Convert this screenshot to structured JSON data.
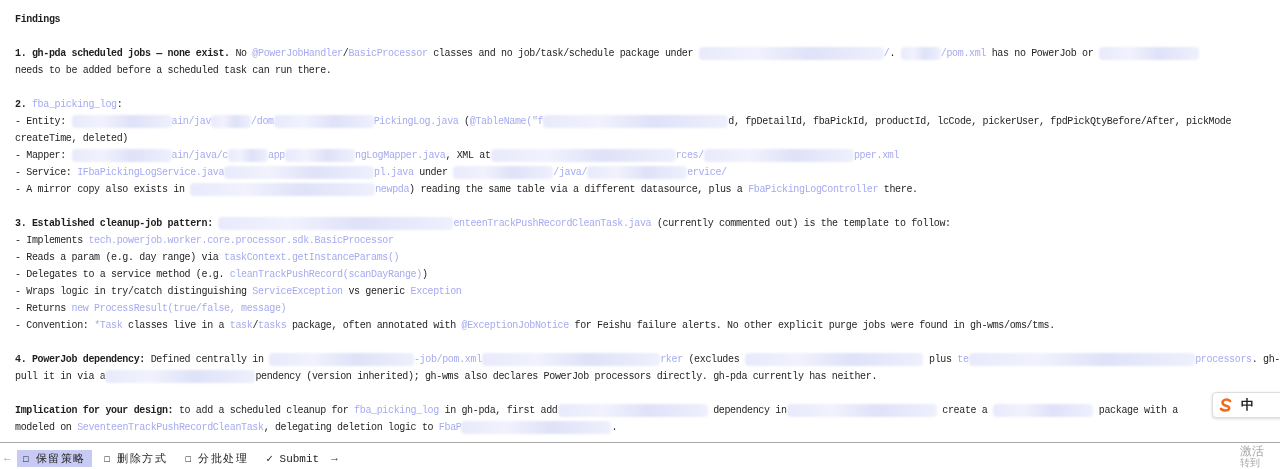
{
  "title": "Findings",
  "sections": [
    {
      "lines": [
        [
          {
            "kind": "bold",
            "t": "1. gh-pda scheduled jobs — none exist."
          },
          {
            "kind": "plain",
            "t": " No "
          },
          {
            "kind": "code",
            "t": "@PowerJobHandler"
          },
          {
            "kind": "plain",
            "t": "/"
          },
          {
            "kind": "code",
            "t": "BasicProcessor"
          },
          {
            "kind": "plain",
            "t": " classes and no job/task/schedule package under "
          },
          {
            "kind": "blurxxl"
          },
          {
            "kind": "code",
            "t": "/"
          },
          {
            "kind": "plain",
            "t": ". "
          },
          {
            "kind": "blurs"
          },
          {
            "kind": "code",
            "t": "/pom.xml"
          },
          {
            "kind": "plain",
            "t": " has no PowerJob or "
          },
          {
            "kind": "blurl"
          }
        ],
        [
          {
            "kind": "plain",
            "t": "needs to be added before a scheduled task can run there."
          }
        ]
      ]
    },
    {
      "lines": [
        [
          {
            "kind": "bold",
            "t": "2. "
          },
          {
            "kind": "code",
            "t": "fba_picking_log"
          },
          {
            "kind": "plain",
            "t": ":"
          }
        ],
        [
          {
            "kind": "plain",
            "t": "- Entity: "
          },
          {
            "kind": "blurl"
          },
          {
            "kind": "code",
            "t": "ain/jav"
          },
          {
            "kind": "blurs"
          },
          {
            "kind": "code",
            "t": "/dom"
          },
          {
            "kind": "blurl"
          },
          {
            "kind": "code",
            "t": "PickingLog.java"
          },
          {
            "kind": "plain",
            "t": " ("
          },
          {
            "kind": "code",
            "t": "@TableName(\"f"
          },
          {
            "kind": "blurxxl"
          },
          {
            "kind": "plain",
            "t": "d, fpDetailId, fbaPickId, productId, lcCode, pickerUser, fpdPickQtyBefore/After, pickMode"
          }
        ],
        [
          {
            "kind": "plain",
            "t": "createTime, deleted)"
          }
        ],
        [
          {
            "kind": "plain",
            "t": "- Mapper: "
          },
          {
            "kind": "blurl"
          },
          {
            "kind": "code",
            "t": "ain/java/c"
          },
          {
            "kind": "blurs"
          },
          {
            "kind": "code",
            "t": "app"
          },
          {
            "kind": "blurm"
          },
          {
            "kind": "code",
            "t": "ngLogMapper.java"
          },
          {
            "kind": "plain",
            "t": ", XML at"
          },
          {
            "kind": "blurxxl"
          },
          {
            "kind": "code",
            "t": "rces/"
          },
          {
            "kind": "blurxl"
          },
          {
            "kind": "code",
            "t": "pper.xml"
          }
        ],
        [
          {
            "kind": "plain",
            "t": "- Service: "
          },
          {
            "kind": "code",
            "t": "IFbaPickingLogService.java"
          },
          {
            "kind": "blurxl"
          },
          {
            "kind": "code",
            "t": "pl.java"
          },
          {
            "kind": "plain",
            "t": " under "
          },
          {
            "kind": "blurl"
          },
          {
            "kind": "code",
            "t": "/java/"
          },
          {
            "kind": "blurl"
          },
          {
            "kind": "code",
            "t": "ervice/"
          }
        ],
        [
          {
            "kind": "plain",
            "t": "- A mirror copy also exists in "
          },
          {
            "kind": "blurxxl"
          },
          {
            "kind": "code",
            "t": "newpda"
          },
          {
            "kind": "plain",
            "t": ") reading the same table via a different datasource, plus a "
          },
          {
            "kind": "code",
            "t": "FbaPickingLogController"
          },
          {
            "kind": "plain",
            "t": " there."
          }
        ]
      ]
    },
    {
      "lines": [
        [
          {
            "kind": "bold",
            "t": "3. Established cleanup-job pattern: "
          },
          {
            "kind": "blurxxxl"
          },
          {
            "kind": "code",
            "t": "enteenTrackPushRecordCleanTask.java"
          },
          {
            "kind": "plain",
            "t": " (currently commented out) is the template to follow:"
          }
        ],
        [
          {
            "kind": "plain",
            "t": "- Implements "
          },
          {
            "kind": "code",
            "t": "tech.powerjob.worker.core.processor.sdk.BasicProcessor"
          }
        ],
        [
          {
            "kind": "plain",
            "t": "- Reads a param (e.g. day range) via "
          },
          {
            "kind": "code",
            "t": "taskContext.getInstanceParams()"
          }
        ],
        [
          {
            "kind": "plain",
            "t": "- Delegates to a service method (e.g. "
          },
          {
            "kind": "code",
            "t": "cleanTrackPushRecord(scanDayRange)"
          },
          {
            "kind": "plain",
            "t": ")"
          }
        ],
        [
          {
            "kind": "plain",
            "t": "- Wraps logic in try/catch distinguishing "
          },
          {
            "kind": "code",
            "t": "ServiceException"
          },
          {
            "kind": "plain",
            "t": " vs generic "
          },
          {
            "kind": "code",
            "t": "Exception"
          }
        ],
        [
          {
            "kind": "plain",
            "t": "- Returns "
          },
          {
            "kind": "code",
            "t": "new ProcessResult(true/false, message)"
          }
        ],
        [
          {
            "kind": "plain",
            "t": "- Convention: "
          },
          {
            "kind": "code",
            "t": "*Task"
          },
          {
            "kind": "plain",
            "t": " classes live in a "
          },
          {
            "kind": "code",
            "t": "task"
          },
          {
            "kind": "plain",
            "t": "/"
          },
          {
            "kind": "code",
            "t": "tasks"
          },
          {
            "kind": "plain",
            "t": " package, often annotated with "
          },
          {
            "kind": "code",
            "t": "@ExceptionJobNotice"
          },
          {
            "kind": "plain",
            "t": " for Feishu failure alerts. No other explicit purge jobs were found in gh-wms/oms/tms."
          }
        ]
      ]
    },
    {
      "lines": [
        [
          {
            "kind": "bold",
            "t": "4. PowerJob dependency:"
          },
          {
            "kind": "plain",
            "t": " Defined centrally in "
          },
          {
            "kind": "blurxl"
          },
          {
            "kind": "code",
            "t": "-job/pom.xml"
          },
          {
            "kind": "blurxxl"
          },
          {
            "kind": "code",
            "t": "rker"
          },
          {
            "kind": "plain",
            "t": " (excludes "
          },
          {
            "kind": "blurxxl"
          },
          {
            "kind": "plain",
            "t": " plus "
          },
          {
            "kind": "code",
            "t": "te"
          },
          {
            "kind": "blurxxxl"
          },
          {
            "kind": "code",
            "t": "processors"
          },
          {
            "kind": "plain",
            "t": ". gh-"
          }
        ],
        [
          {
            "kind": "plain",
            "t": "pull it in via a"
          },
          {
            "kind": "blurxl"
          },
          {
            "kind": "plain",
            "t": "pendency (version inherited); gh-wms also declares PowerJob processors directly. gh-pda currently has neither."
          }
        ]
      ]
    },
    {
      "lines": [
        [
          {
            "kind": "bold",
            "t": "Implication for your design:"
          },
          {
            "kind": "plain",
            "t": " to add a scheduled cleanup for "
          },
          {
            "kind": "code",
            "t": "fba_picking_log"
          },
          {
            "kind": "plain",
            "t": " in gh-pda, first add"
          },
          {
            "kind": "blurxl"
          },
          {
            "kind": "plain",
            "t": " dependency in"
          },
          {
            "kind": "blurxl"
          },
          {
            "kind": "plain",
            "t": " create a "
          },
          {
            "kind": "blurl"
          },
          {
            "kind": "plain",
            "t": " package with a"
          }
        ],
        [
          {
            "kind": "plain",
            "t": "modeled on "
          },
          {
            "kind": "code",
            "t": "SeventeenTrackPushRecordCleanTask"
          },
          {
            "kind": "plain",
            "t": ", delegating deletion logic to "
          },
          {
            "kind": "code",
            "t": "FbaP"
          },
          {
            "kind": "blurxl"
          },
          {
            "kind": "plain",
            "t": "."
          }
        ]
      ]
    }
  ],
  "ime_toolbar": {
    "mode": "中"
  },
  "bottom_bar": {
    "prev": "←",
    "next": "→",
    "tabs": [
      {
        "mark": "☐",
        "label": "保留策略",
        "selected": true
      },
      {
        "mark": "☐",
        "label": "删除方式",
        "selected": false
      },
      {
        "mark": "☐",
        "label": "分批处理",
        "selected": false
      }
    ],
    "submit": {
      "mark": "✓",
      "label": "Submit"
    }
  },
  "os_notice": [
    "激活",
    "转到"
  ]
}
